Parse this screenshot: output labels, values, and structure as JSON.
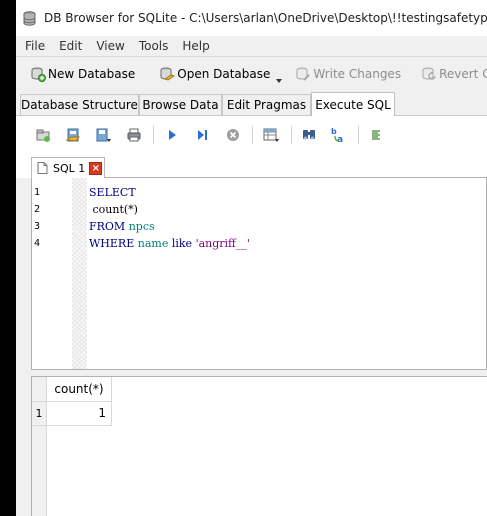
{
  "window": {
    "title": "DB Browser for SQLite - C:\\Users\\arlan\\OneDrive\\Desktop\\!!testingsafetyplugins\\Np"
  },
  "menu": [
    "File",
    "Edit",
    "View",
    "Tools",
    "Help"
  ],
  "toolbar": {
    "new_database": "New Database",
    "open_database": "Open Database",
    "write_changes": "Write Changes",
    "revert_changes": "Revert Changes"
  },
  "tabs": [
    {
      "label": "Database Structure",
      "active": false
    },
    {
      "label": "Browse Data",
      "active": false
    },
    {
      "label": "Edit Pragmas",
      "active": false
    },
    {
      "label": "Execute SQL",
      "active": true
    }
  ],
  "sql_toolbar_icons": [
    "open-tab-icon",
    "open-sql-file-icon",
    "save-sql-file-icon",
    "print-icon",
    "execute-all-icon",
    "execute-line-icon",
    "stop-icon",
    "save-results-icon",
    "find-icon",
    "find-replace-icon",
    "comment-icon"
  ],
  "editor_tab": {
    "label": "SQL 1",
    "close": "×"
  },
  "editor": {
    "lines": [
      {
        "n": "1",
        "tokens": [
          {
            "t": "SELECT",
            "c": "kw"
          }
        ]
      },
      {
        "n": "2",
        "tokens": [
          {
            "t": " count",
            "c": "fn"
          },
          {
            "t": "(*)",
            "c": "fn"
          }
        ]
      },
      {
        "n": "3",
        "tokens": [
          {
            "t": "FROM",
            "c": "kw"
          },
          {
            "t": " ",
            "c": "fn"
          },
          {
            "t": "npcs",
            "c": "id"
          }
        ]
      },
      {
        "n": "4",
        "tokens": [
          {
            "t": "WHERE",
            "c": "kw"
          },
          {
            "t": " ",
            "c": "fn"
          },
          {
            "t": "name",
            "c": "id"
          },
          {
            "t": " ",
            "c": "fn"
          },
          {
            "t": "like",
            "c": "kw"
          },
          {
            "t": " ",
            "c": "fn"
          },
          {
            "t": "'angriff__'",
            "c": "str"
          }
        ]
      }
    ]
  },
  "results": {
    "columns": [
      "count(*)"
    ],
    "rows": [
      {
        "num": "1",
        "cells": [
          "1"
        ]
      }
    ]
  },
  "colors": {
    "keyword": "#00007f",
    "identifier": "#007f7f",
    "string": "#7f007f",
    "accent_execute": "#2a6fcf"
  }
}
